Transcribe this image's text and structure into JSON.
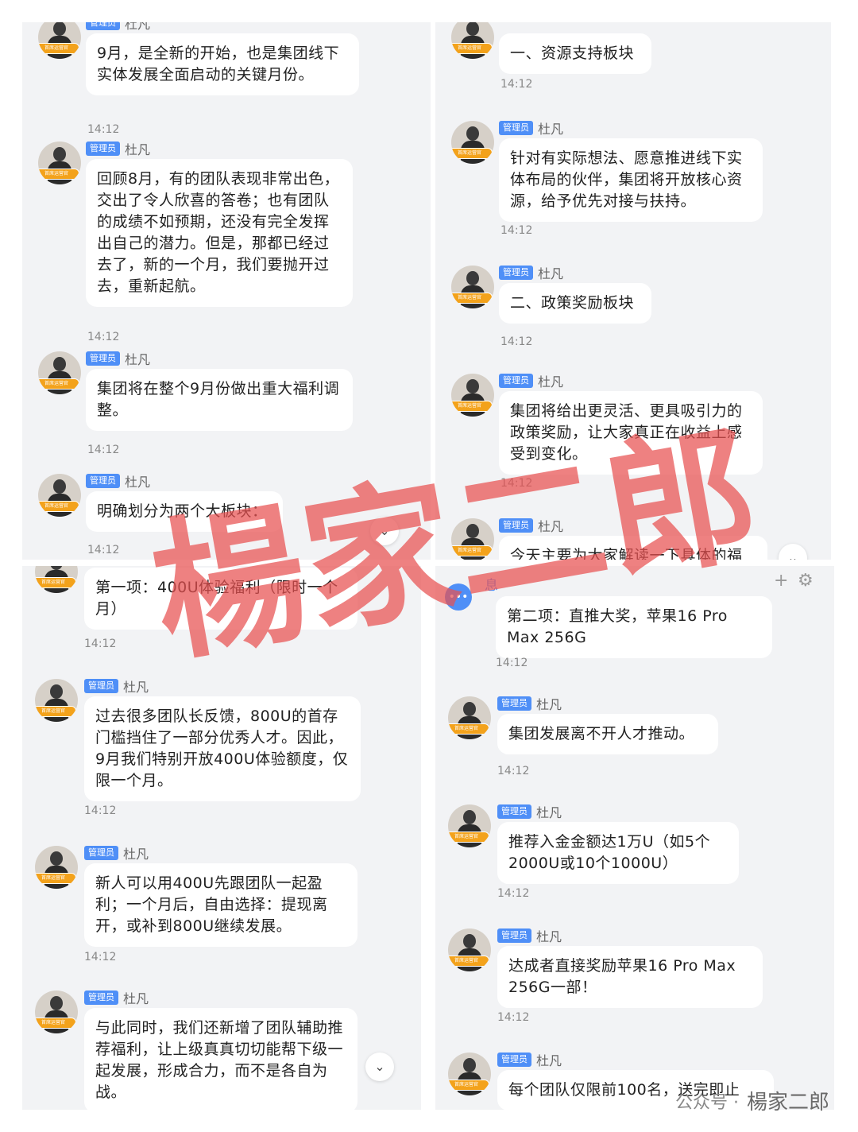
{
  "sender": {
    "badge": "管理员",
    "name": "杜凡",
    "avatar_tag": "首席运营官"
  },
  "panels": {
    "tl": [
      {
        "text": "9月，是全新的开始，也是集团线下实体发展全面启动的关键月份。",
        "time": "14:12"
      },
      {
        "text": "回顾8月，有的团队表现非常出色，交出了令人欣喜的答卷；也有团队的成绩不如预期，还没有完全发挥出自己的潜力。但是，那都已经过去了，新的一个月，我们要抛开过去，重新起航。",
        "time": "14:12"
      },
      {
        "text": "集团将在整个9月份做出重大福利调整。",
        "time": "14:12"
      },
      {
        "text": "明确划分为两个大板块：",
        "time": "14:12"
      }
    ],
    "tr": [
      {
        "text": "一、资源支持板块",
        "time": "14:12"
      },
      {
        "text": "针对有实际想法、愿意推进线下实体布局的伙伴，集团将开放核心资源，给予优先对接与扶持。",
        "time": "14:12"
      },
      {
        "text": "二、政策奖励板块",
        "time": "14:12"
      },
      {
        "text": "集团将给出更灵活、更具吸引力的政策奖励，让大家真正在收益上感受到变化。",
        "time": "14:12"
      },
      {
        "text": "今天主要为大家解读一下具体的福",
        "time": ""
      }
    ],
    "bl": [
      {
        "text": "第一项：400U体验福利（限时一个月）",
        "time": "14:12"
      },
      {
        "text": "过去很多团队长反馈，800U的首存门槛挡住了一部分优秀人才。因此，9月我们特别开放400U体验额度，仅限一个月。",
        "time": "14:12"
      },
      {
        "text": "新人可以用400U先跟团队一起盈利；一个月后，自由选择：提现离开，或补到800U继续发展。",
        "time": "14:12"
      },
      {
        "text": "与此同时，我们还新增了团队辅助推荐福利，让上级真真切切能帮下级一起发展，形成合力，而不是各自为战。",
        "time": ""
      }
    ],
    "br": [
      {
        "text": "第二项：直推大奖，苹果16 Pro Max 256G",
        "time": "14:12"
      },
      {
        "text": "集团发展离不开人才推动。",
        "time": "14:12"
      },
      {
        "text": "推荐入金金额达1万U（如5个2000U或10个1000U）",
        "time": "14:12"
      },
      {
        "text": "达成者直接奖励苹果16 Pro Max 256G一部！",
        "time": "14:12"
      },
      {
        "text": "每个团队仅限前100名，送完即止",
        "time": ""
      }
    ]
  },
  "header_br": {
    "label": "息"
  },
  "watermark": "楊家二郎",
  "footer": {
    "source": "公众号 ·",
    "author": "楊家二郎"
  },
  "icons": {
    "scroll": "chevron-double-down-icon",
    "add": "plus-icon",
    "settings": "gear-icon"
  },
  "colors": {
    "badge": "#4f8ff7",
    "tag": "#f3a21b",
    "watermark": "#e85050"
  }
}
